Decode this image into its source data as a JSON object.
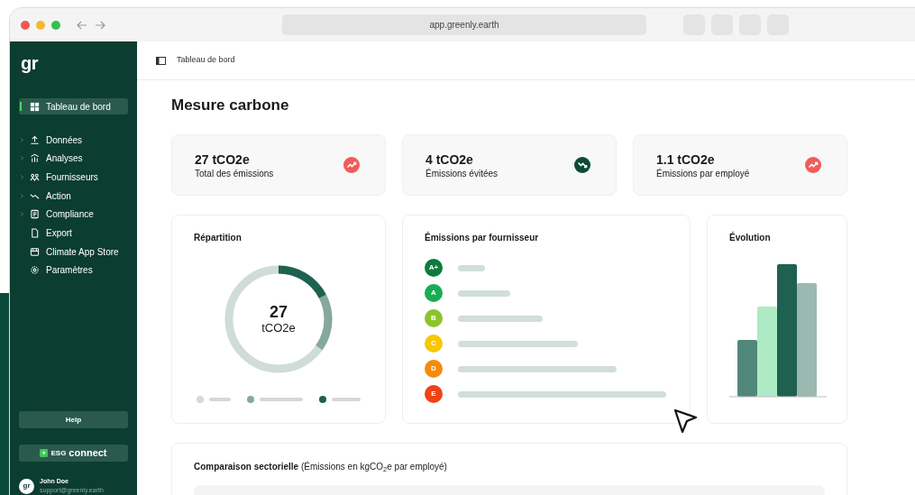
{
  "browser": {
    "url": "app.greenly.earth"
  },
  "sidebar": {
    "logo": "gr",
    "items": [
      {
        "label": "Tableau de bord",
        "selected": true,
        "expandable": false
      },
      {
        "label": "Données",
        "selected": false,
        "expandable": true
      },
      {
        "label": "Analyses",
        "selected": false,
        "expandable": true
      },
      {
        "label": "Fournisseurs",
        "selected": false,
        "expandable": true
      },
      {
        "label": "Action",
        "selected": false,
        "expandable": true
      },
      {
        "label": "Compliance",
        "selected": false,
        "expandable": true
      },
      {
        "label": "Export",
        "selected": false,
        "expandable": false
      },
      {
        "label": "Climate App Store",
        "selected": false,
        "expandable": false
      },
      {
        "label": "Paramètres",
        "selected": false,
        "expandable": false
      }
    ],
    "help": "Help",
    "esg": {
      "brand": "ESG",
      "word": "connect"
    },
    "user": {
      "avatar": "gr",
      "name": "John Doe",
      "email": "support@greenly.earth"
    }
  },
  "breadcrumb": "Tableau de bord",
  "title": "Mesure carbone",
  "kpis": [
    {
      "value": "27 tCO2e",
      "label": "Total des émissions",
      "kind": "up"
    },
    {
      "value": "4 tCO2e",
      "label": "Émissions évitées",
      "kind": "down"
    },
    {
      "value": "1.1 tCO2e",
      "label": "Émissions par employé",
      "kind": "up"
    }
  ],
  "repartition": {
    "title": "Répartition",
    "value": "27",
    "unit": "tCO2e",
    "legend": [
      {
        "color": "#cfdcd7"
      },
      {
        "color": "#86a89d"
      },
      {
        "color": "#1f6150"
      }
    ]
  },
  "suppliers": {
    "title": "Émissions par fournisseur",
    "grades": [
      {
        "label": "A+",
        "color": "#0f7a3e"
      },
      {
        "label": "A",
        "color": "#18ad55"
      },
      {
        "label": "B",
        "color": "#8cc42c"
      },
      {
        "label": "C",
        "color": "#f5c800"
      },
      {
        "label": "D",
        "color": "#f78a0a"
      },
      {
        "label": "E",
        "color": "#f04214"
      }
    ]
  },
  "evolution": {
    "title": "Évolution"
  },
  "comparison": {
    "title": "**Comparaison sectorielle** (Émissions en kgCO$_{2}$e par employé)"
  }
}
